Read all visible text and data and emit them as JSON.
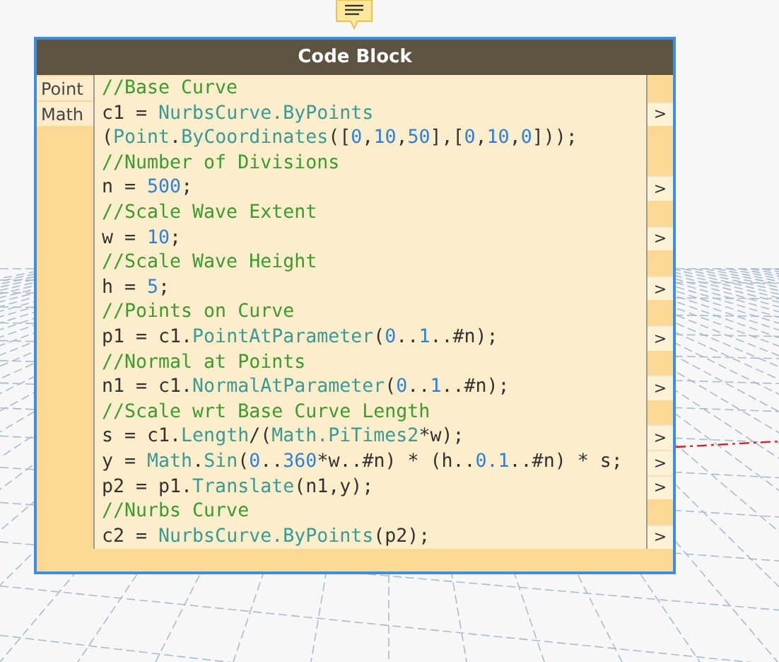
{
  "node": {
    "title": "Code Block",
    "inputs": [
      "Point",
      "Math"
    ],
    "lines": [
      {
        "tokens": [
          {
            "text": "//Base Curve",
            "kind": "comment"
          }
        ]
      },
      {
        "port": ">",
        "tokens": [
          {
            "text": "c1 = ",
            "kind": "plain"
          },
          {
            "text": "NurbsCurve.ByPoints",
            "kind": "type"
          }
        ]
      },
      {
        "tokens": [
          {
            "text": "(",
            "kind": "plain"
          },
          {
            "text": "Point",
            "kind": "type"
          },
          {
            "text": ".",
            "kind": "plain"
          },
          {
            "text": "ByCoordinates",
            "kind": "type"
          },
          {
            "text": "([",
            "kind": "plain"
          },
          {
            "text": "0",
            "kind": "number"
          },
          {
            "text": ",",
            "kind": "plain"
          },
          {
            "text": "10",
            "kind": "number"
          },
          {
            "text": ",",
            "kind": "plain"
          },
          {
            "text": "50",
            "kind": "number"
          },
          {
            "text": "],[",
            "kind": "plain"
          },
          {
            "text": "0",
            "kind": "number"
          },
          {
            "text": ",",
            "kind": "plain"
          },
          {
            "text": "10",
            "kind": "number"
          },
          {
            "text": ",",
            "kind": "plain"
          },
          {
            "text": "0",
            "kind": "number"
          },
          {
            "text": "]));",
            "kind": "plain"
          }
        ]
      },
      {
        "tokens": [
          {
            "text": "//Number of Divisions",
            "kind": "comment"
          }
        ]
      },
      {
        "port": ">",
        "tokens": [
          {
            "text": "n = ",
            "kind": "plain"
          },
          {
            "text": "500",
            "kind": "number"
          },
          {
            "text": ";",
            "kind": "plain"
          }
        ]
      },
      {
        "tokens": [
          {
            "text": "//Scale Wave Extent",
            "kind": "comment"
          }
        ]
      },
      {
        "port": ">",
        "tokens": [
          {
            "text": "w = ",
            "kind": "plain"
          },
          {
            "text": "10",
            "kind": "number"
          },
          {
            "text": ";",
            "kind": "plain"
          }
        ]
      },
      {
        "tokens": [
          {
            "text": "//Scale Wave Height",
            "kind": "comment"
          }
        ]
      },
      {
        "port": ">",
        "tokens": [
          {
            "text": "h = ",
            "kind": "plain"
          },
          {
            "text": "5",
            "kind": "number"
          },
          {
            "text": ";",
            "kind": "plain"
          }
        ]
      },
      {
        "tokens": [
          {
            "text": "//Points on Curve",
            "kind": "comment"
          }
        ]
      },
      {
        "port": ">",
        "tokens": [
          {
            "text": "p1 = c1.",
            "kind": "plain"
          },
          {
            "text": "PointAtParameter",
            "kind": "type"
          },
          {
            "text": "(",
            "kind": "plain"
          },
          {
            "text": "0",
            "kind": "number"
          },
          {
            "text": "..",
            "kind": "plain"
          },
          {
            "text": "1",
            "kind": "number"
          },
          {
            "text": "..#n);",
            "kind": "plain"
          }
        ]
      },
      {
        "tokens": [
          {
            "text": "//Normal at Points",
            "kind": "comment"
          }
        ]
      },
      {
        "port": ">",
        "tokens": [
          {
            "text": "n1 = c1.",
            "kind": "plain"
          },
          {
            "text": "NormalAtParameter",
            "kind": "type"
          },
          {
            "text": "(",
            "kind": "plain"
          },
          {
            "text": "0",
            "kind": "number"
          },
          {
            "text": "..",
            "kind": "plain"
          },
          {
            "text": "1",
            "kind": "number"
          },
          {
            "text": "..#n);",
            "kind": "plain"
          }
        ]
      },
      {
        "tokens": [
          {
            "text": "//Scale wrt Base Curve Length",
            "kind": "comment"
          }
        ]
      },
      {
        "port": ">",
        "tokens": [
          {
            "text": "s = c1.",
            "kind": "plain"
          },
          {
            "text": "Length",
            "kind": "type"
          },
          {
            "text": "/(",
            "kind": "plain"
          },
          {
            "text": "Math.PiTimes2",
            "kind": "type"
          },
          {
            "text": "*w);",
            "kind": "plain"
          }
        ]
      },
      {
        "port": ">",
        "tokens": [
          {
            "text": "y = ",
            "kind": "plain"
          },
          {
            "text": "Math",
            "kind": "type"
          },
          {
            "text": ".",
            "kind": "plain"
          },
          {
            "text": "Sin",
            "kind": "type"
          },
          {
            "text": "(",
            "kind": "plain"
          },
          {
            "text": "0",
            "kind": "number"
          },
          {
            "text": "..",
            "kind": "plain"
          },
          {
            "text": "360",
            "kind": "number"
          },
          {
            "text": "*w..#n) * (h..",
            "kind": "plain"
          },
          {
            "text": "0.1",
            "kind": "number"
          },
          {
            "text": "..#n) * s;",
            "kind": "plain"
          }
        ]
      },
      {
        "port": ">",
        "tokens": [
          {
            "text": "p2 = p1.",
            "kind": "plain"
          },
          {
            "text": "Translate",
            "kind": "type"
          },
          {
            "text": "(n1,y);",
            "kind": "plain"
          }
        ]
      },
      {
        "tokens": [
          {
            "text": "//Nurbs Curve",
            "kind": "comment"
          }
        ]
      },
      {
        "port": ">",
        "tokens": [
          {
            "text": "c2 = ",
            "kind": "plain"
          },
          {
            "text": "NurbsCurve.ByPoints",
            "kind": "type"
          },
          {
            "text": "(p2);",
            "kind": "plain"
          }
        ]
      }
    ]
  }
}
